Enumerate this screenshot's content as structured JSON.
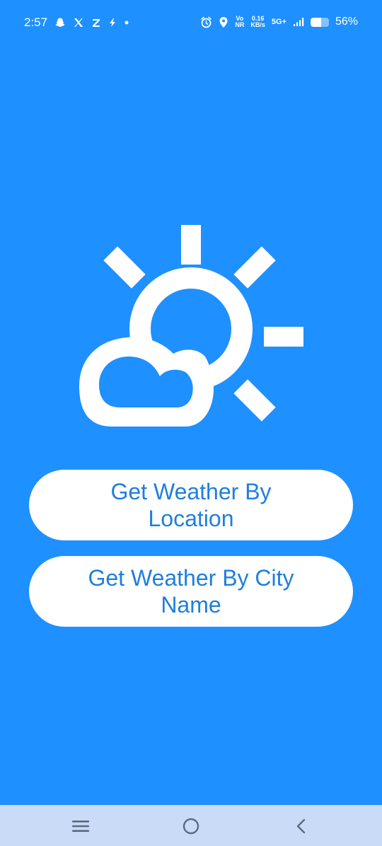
{
  "status_bar": {
    "time": "2:57",
    "left_icons": [
      "snapchat-icon",
      "x-icon",
      "z-icon",
      "lightning-icon",
      "dot-icon"
    ],
    "network_rate_value": "0.16",
    "network_rate_unit": "KB/s",
    "volte_top": "Vo",
    "volte_bottom": "NR",
    "network_type": "5G+",
    "battery_percent": "56%",
    "battery_level": 0.56
  },
  "main": {
    "icon": "sun-cloud-icon",
    "buttons": {
      "location_label": "Get Weather By Location",
      "city_label": "Get Weather By City Name"
    }
  },
  "colors": {
    "background": "#1e90ff",
    "button_background": "#ffffff",
    "button_text": "#1e7fdc",
    "nav_background": "#c9dbf6",
    "nav_icon": "#5a6b80"
  },
  "nav_bar": {
    "icons": [
      "menu-icon",
      "home-icon",
      "back-icon"
    ]
  }
}
